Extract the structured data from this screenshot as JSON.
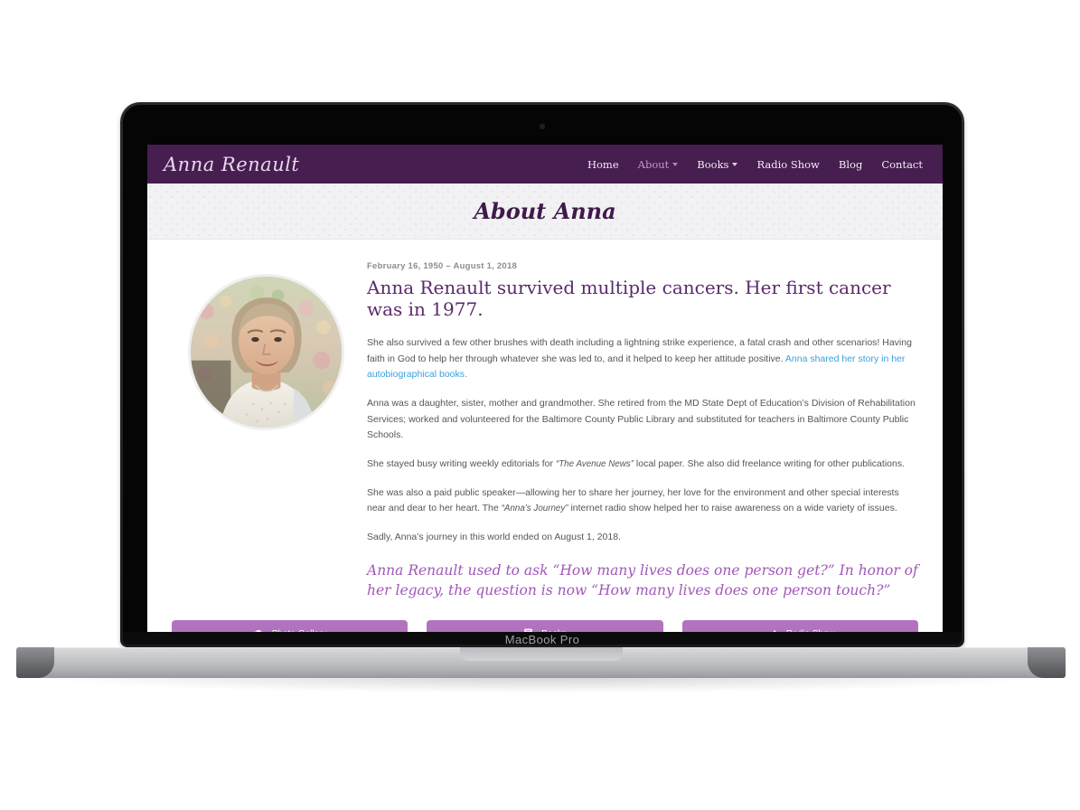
{
  "device": {
    "label": "MacBook Pro",
    "webcam_icon": "webcam-dot"
  },
  "site": {
    "brand": "Anna Renault",
    "nav": [
      {
        "label": "Home",
        "active": false,
        "has_dropdown": false
      },
      {
        "label": "About",
        "active": true,
        "has_dropdown": true
      },
      {
        "label": "Books",
        "active": false,
        "has_dropdown": true
      },
      {
        "label": "Radio Show",
        "active": false,
        "has_dropdown": false
      },
      {
        "label": "Blog",
        "active": false,
        "has_dropdown": false
      },
      {
        "label": "Contact",
        "active": false,
        "has_dropdown": false
      }
    ],
    "page_title": "About Anna",
    "portrait_alt": "Anna Renault portrait",
    "lifespan": "February 16, 1950 – August 1, 2018",
    "headline": "Anna Renault survived multiple cancers. Her first cancer was in 1977.",
    "paragraph_1_before_link": "She also survived a few other brushes with death including a lightning strike experience, a fatal crash and other scenarios! Having faith in God to help her through whatever she was led to, and it helped to keep her attitude positive. ",
    "paragraph_1_link": "Anna shared her story in her autobiographical books.",
    "paragraph_2": "Anna was a daughter, sister, mother and grandmother. She retired from the MD State Dept of Education’s Division of Rehabilitation Services; worked and volunteered for the Baltimore County Public Library and substituted for teachers in Baltimore County Public Schools.",
    "paragraph_3_part_a": "She stayed busy writing weekly editorials for ",
    "paragraph_3_italic": "“The Avenue News”",
    "paragraph_3_part_b": " local paper. She also did freelance writing for other publications.",
    "paragraph_4_part_a": "She was also a paid public speaker—allowing her to share her journey, her love for the environment and other special interests near and dear to her heart. The ",
    "paragraph_4_italic": "“Anna’s Journey”",
    "paragraph_4_part_b": " internet radio show helped her to raise awareness on a wide variety of issues.",
    "paragraph_5": "Sadly, Anna’s journey in this world ended on August 1, 2018.",
    "pullquote": "Anna Renault used to ask “How many lives does one person get?” In honor of her legacy, the question is now “How many lives does one person touch?”",
    "buttons": [
      {
        "label": "Photo Gallery",
        "icon": "camera-icon"
      },
      {
        "label": "Books",
        "icon": "book-icon"
      },
      {
        "label": "Radio Show",
        "icon": "megaphone-icon"
      }
    ],
    "colors": {
      "nav_purple": "#461e4f",
      "brand_lavender": "#e8d7ee",
      "nav_active": "#c696d4",
      "heading_purple": "#5b2a6b",
      "quote_purple": "#a058b8",
      "button_purple": "#b173bf",
      "link_blue": "#3ba0dd",
      "banner_grey": "#f2f1f3",
      "body_text": "#55565a"
    }
  }
}
